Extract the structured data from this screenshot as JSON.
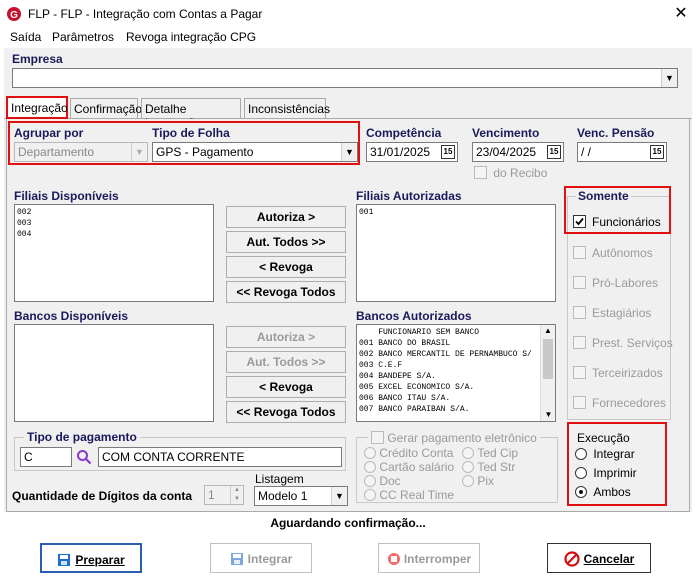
{
  "window": {
    "title": "FLP -  FLP - Integração com Contas a Pagar",
    "close": "✕"
  },
  "menu": [
    "Saída",
    "Parâmetros",
    "Revoga integração CPG"
  ],
  "empresa": {
    "label": "Empresa",
    "value": ""
  },
  "tabs": [
    "Integração",
    "Confirmação",
    "Detalhe Integração",
    "Inconsistências"
  ],
  "agrupar": {
    "label": "Agrupar por",
    "value": "Departamento"
  },
  "tipo_folha": {
    "label": "Tipo de Folha",
    "value": "GPS - Pagamento"
  },
  "competencia": {
    "label": "Competência",
    "value": "31/01/2025"
  },
  "vencimento": {
    "label": "Vencimento",
    "value": "23/04/2025"
  },
  "venc_pensao": {
    "label": "Venc. Pensão",
    "value": " / /"
  },
  "do_recibo": "do Recibo",
  "filiais_disponiveis": {
    "label": "Filiais Disponíveis",
    "items": [
      "002",
      "003",
      "004"
    ]
  },
  "filiais_autorizadas": {
    "label": "Filiais Autorizadas",
    "items": [
      "001"
    ]
  },
  "filial_buttons": [
    "Autoriza >",
    "Aut. Todos >>",
    "< Revoga",
    "<< Revoga Todos"
  ],
  "bancos_disponiveis": {
    "label": "Bancos Disponíveis",
    "items": []
  },
  "bancos_autorizados": {
    "label": "Bancos Autorizados",
    "items": [
      "    FUNCIONARIO SEM BANCO",
      "001 BANCO DO BRASIL",
      "002 BANCO MERCANTIL DE PERNAMBUCO S/",
      "003 C.E.F",
      "004 BANDEPE S/A.",
      "005 EXCEL ECONOMICO S/A.",
      "006 BANCO ITAU S/A.",
      "007 BANCO PARAIBAN S/A."
    ]
  },
  "banco_buttons": [
    "Autoriza >",
    "Aut. Todos >>",
    "< Revoga",
    "<< Revoga Todos"
  ],
  "somente": {
    "label": "Somente",
    "items": [
      {
        "label": "Funcionários",
        "checked": true,
        "enabled": true
      },
      {
        "label": "Autônomos",
        "checked": false,
        "enabled": false
      },
      {
        "label": "Pró-Labores",
        "checked": false,
        "enabled": false
      },
      {
        "label": "Estagiários",
        "checked": false,
        "enabled": false
      },
      {
        "label": "Prest. Serviços",
        "checked": false,
        "enabled": false
      },
      {
        "label": "Terceirizados",
        "checked": false,
        "enabled": false
      },
      {
        "label": "Fornecedores",
        "checked": false,
        "enabled": false
      }
    ]
  },
  "tipo_pagamento": {
    "label": "Tipo de pagamento",
    "code": "C",
    "description": "COM CONTA CORRENTE"
  },
  "gerar_pagamento": {
    "label": "Gerar pagamento eletrônico",
    "options": [
      "Crédito Conta",
      "Ted Cip",
      "Cartão salário",
      "Ted Str",
      "Doc",
      "Pix",
      "CC Real Time"
    ]
  },
  "quantidade_digitos": {
    "label": "Quantidade de Dígitos da conta",
    "value": "1"
  },
  "listagem": {
    "label": "Listagem",
    "value": "Modelo 1"
  },
  "execucao": {
    "label": "Execução",
    "options": [
      "Integrar",
      "Imprimir",
      "Ambos"
    ],
    "selected": "Ambos"
  },
  "status": "Aguardando confirmação...",
  "footer_buttons": {
    "preparar": "Preparar",
    "integrar": "Integrar",
    "interromper": "Interromper",
    "cancelar": "Cancelar"
  },
  "colors": {
    "accent_red": "#e01010",
    "primary_border": "#2a5db0",
    "app_icon_red": "#c8102e"
  }
}
